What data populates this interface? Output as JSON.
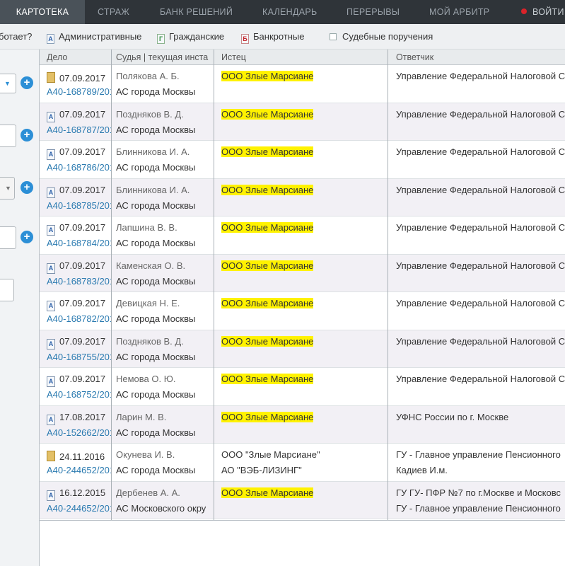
{
  "nav": {
    "items": [
      {
        "label": "КАРТОТЕКА",
        "active": true
      },
      {
        "label": "СТРАЖ",
        "active": false
      },
      {
        "label": "БАНК РЕШЕНИЙ",
        "active": false
      },
      {
        "label": "КАЛЕНДАРЬ",
        "active": false
      },
      {
        "label": "ПЕРЕРЫВЫ",
        "active": false
      },
      {
        "label": "МОЙ АРБИТР",
        "active": false
      }
    ],
    "login_label": "ВОЙТИ"
  },
  "filters": {
    "how_it_works_partial": "ботает?",
    "admin": {
      "icon": "А",
      "label": "Административные"
    },
    "civil": {
      "icon": "Г",
      "label": "Гражданские"
    },
    "bankrupt": {
      "icon": "Б",
      "label": "Банкротные"
    },
    "court_orders": {
      "label": "Судебные поручения"
    }
  },
  "table": {
    "headers": [
      "Дело",
      "Судья | текущая инста",
      "Истец",
      "Ответчик"
    ],
    "rows": [
      {
        "icon": "gold",
        "date": "07.09.2017",
        "case": "А40-168789/201",
        "judge": "Полякова А. Б.",
        "court": "АС города Москвы",
        "plaintiff": [
          "ООО Злые Марсиане"
        ],
        "plaintiff_hl": true,
        "defendant": [
          "Управление Федеральной Налоговой С"
        ]
      },
      {
        "icon": "А",
        "date": "07.09.2017",
        "case": "А40-168787/201",
        "judge": "Поздняков В. Д.",
        "court": "АС города Москвы",
        "plaintiff": [
          "ООО Злые Марсиане"
        ],
        "plaintiff_hl": true,
        "defendant": [
          "Управление Федеральной Налоговой С"
        ]
      },
      {
        "icon": "А",
        "date": "07.09.2017",
        "case": "А40-168786/201",
        "judge": "Блинникова И. А.",
        "court": "АС города Москвы",
        "plaintiff": [
          "ООО Злые Марсиане"
        ],
        "plaintiff_hl": true,
        "defendant": [
          "Управление Федеральной Налоговой С"
        ]
      },
      {
        "icon": "А",
        "date": "07.09.2017",
        "case": "А40-168785/201",
        "judge": "Блинникова И. А.",
        "court": "АС города Москвы",
        "plaintiff": [
          "ООО Злые Марсиане"
        ],
        "plaintiff_hl": true,
        "defendant": [
          "Управление Федеральной Налоговой С"
        ]
      },
      {
        "icon": "А",
        "date": "07.09.2017",
        "case": "А40-168784/201",
        "judge": "Лапшина В. В.",
        "court": "АС города Москвы",
        "plaintiff": [
          "ООО Злые Марсиане"
        ],
        "plaintiff_hl": true,
        "defendant": [
          "Управление Федеральной Налоговой С"
        ]
      },
      {
        "icon": "А",
        "date": "07.09.2017",
        "case": "А40-168783/201",
        "judge": "Каменская О. В.",
        "court": "АС города Москвы",
        "plaintiff": [
          "ООО Злые Марсиане"
        ],
        "plaintiff_hl": true,
        "defendant": [
          "Управление Федеральной Налоговой С"
        ]
      },
      {
        "icon": "А",
        "date": "07.09.2017",
        "case": "А40-168782/201",
        "judge": "Девицкая Н. Е.",
        "court": "АС города Москвы",
        "plaintiff": [
          "ООО Злые Марсиане"
        ],
        "plaintiff_hl": true,
        "defendant": [
          "Управление Федеральной Налоговой С"
        ]
      },
      {
        "icon": "А",
        "date": "07.09.2017",
        "case": "А40-168755/201",
        "judge": "Поздняков В. Д.",
        "court": "АС города Москвы",
        "plaintiff": [
          "ООО Злые Марсиане"
        ],
        "plaintiff_hl": true,
        "defendant": [
          "Управление Федеральной Налоговой С"
        ]
      },
      {
        "icon": "А",
        "date": "07.09.2017",
        "case": "А40-168752/201",
        "judge": "Немова О. Ю.",
        "court": "АС города Москвы",
        "plaintiff": [
          "ООО Злые Марсиане"
        ],
        "plaintiff_hl": true,
        "defendant": [
          "Управление Федеральной Налоговой С"
        ]
      },
      {
        "icon": "А",
        "date": "17.08.2017",
        "case": "А40-152662/201",
        "judge": "Ларин М. В.",
        "court": "АС города Москвы",
        "plaintiff": [
          "ООО Злые Марсиане"
        ],
        "plaintiff_hl": true,
        "defendant": [
          "УФНС России по г. Москве"
        ]
      },
      {
        "icon": "gold",
        "date": "24.11.2016",
        "case": "А40-244652/201",
        "judge": "Окунева И. В.",
        "court": "АС города Москвы",
        "plaintiff": [
          "ООО \"Злые Марсиане\"",
          "АО \"ВЭБ-ЛИЗИНГ\""
        ],
        "plaintiff_hl": false,
        "defendant": [
          "ГУ - Главное управление Пенсионного",
          "Кадиев И.м."
        ]
      },
      {
        "icon": "А",
        "date": "16.12.2015",
        "case": "А40-244652/201",
        "judge": "Дербенев А. А.",
        "court": "АС Московского окру",
        "plaintiff": [
          "ООО Злые Марсиане"
        ],
        "plaintiff_hl": true,
        "defendant": [
          "ГУ ГУ- ПФР №7 по г.Москве и Московс",
          "ГУ - Главное управление Пенсионного"
        ]
      }
    ]
  },
  "colors": {
    "nav_bg": "#2f3439",
    "nav_active_bg": "#4a5259",
    "highlight": "#fff200",
    "link": "#2a7ab0",
    "plus_button": "#2c8fd6",
    "login_dot": "#d9232a"
  }
}
